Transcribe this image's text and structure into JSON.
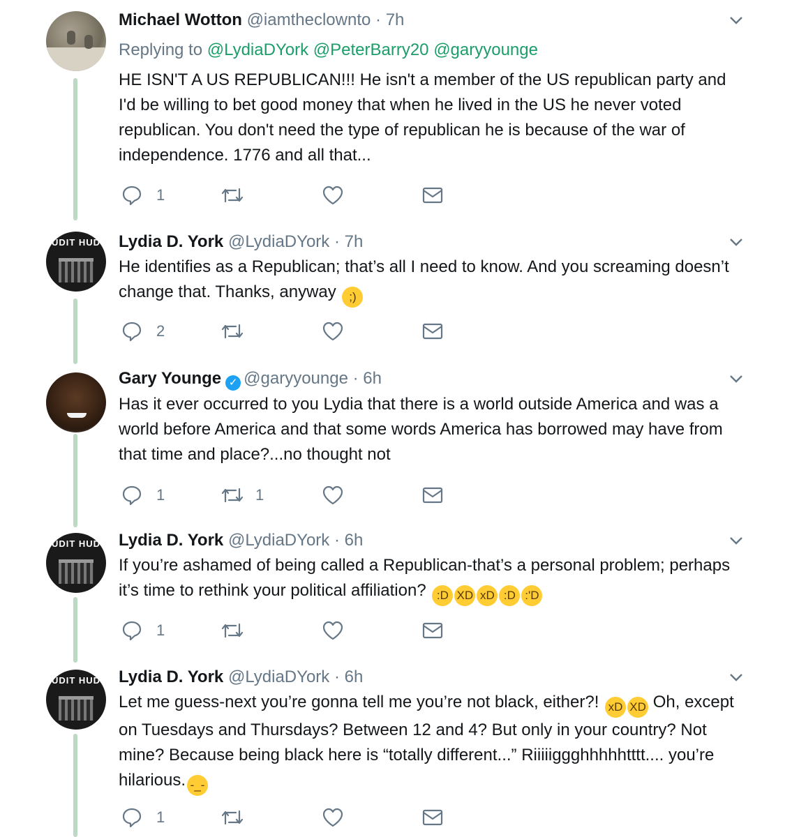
{
  "tweets": [
    {
      "name": "Michael Wotton",
      "handle": "@iamtheclownto",
      "time": "7h",
      "verified": false,
      "reply_prefix": "Replying to",
      "reply_mentions": [
        "@LydiaDYork",
        "@PeterBarry20",
        "@garyyounge"
      ],
      "text": "HE ISN'T A US REPUBLICAN!!! He isn't a member of the US republican party and I'd be willing to bet good money that when he lived in the US he never voted republican. You don't need the type of republican he is because of the war of independence. 1776 and all that...",
      "emojis": [],
      "reply_count": "1",
      "retweet_count": "",
      "avatar_icon": "michael-wotton-avatar"
    },
    {
      "name": "Lydia D. York",
      "handle": "@LydiaDYork",
      "time": "7h",
      "verified": false,
      "text": "He identifies as a Republican; that’s all I need to know. And you screaming doesn’t change that. Thanks, anyway",
      "emojis": [
        "winking-face"
      ],
      "reply_count": "2",
      "retweet_count": "",
      "avatar_text": "UDIT HUD"
    },
    {
      "name": "Gary Younge",
      "handle": "@garyyounge",
      "time": "6h",
      "verified": true,
      "text": "Has it ever occurred to you Lydia that there is a world outside America and was a world before America and that some words America has borrowed may have from that time and place?...no thought not",
      "emojis": [],
      "reply_count": "1",
      "retweet_count": "1",
      "avatar_icon": "gary-younge-avatar"
    },
    {
      "name": "Lydia D. York",
      "handle": "@LydiaDYork",
      "time": "6h",
      "verified": false,
      "text": "If you’re ashamed of being called a Republican-that’s a personal problem; perhaps it’s time to rethink your political affiliation?",
      "emojis": [
        "grinning-squinting-face",
        "laughing-face",
        "rolling-laughing-face",
        "grinning-face",
        "tears-of-joy-face"
      ],
      "reply_count": "1",
      "retweet_count": "",
      "avatar_text": "UDIT HUD"
    },
    {
      "name": "Lydia D. York",
      "handle": "@LydiaDYork",
      "time": "6h",
      "verified": false,
      "text_part1": "Let me guess-next you’re gonna tell me you’re not black, either?!",
      "emojis_mid": [
        "rolling-laughing-face",
        "laughing-face"
      ],
      "text_part2": "Oh, except on Tuesdays and Thursdays? Between 12 and 4? But only in your country? Not mine? Because being black here is “totally different...” Riiiiiggghhhhhtttt.... you’re hilarious.",
      "emojis": [
        "expressionless-face"
      ],
      "reply_count": "1",
      "retweet_count": "",
      "avatar_text": "UDIT HUD"
    }
  ]
}
